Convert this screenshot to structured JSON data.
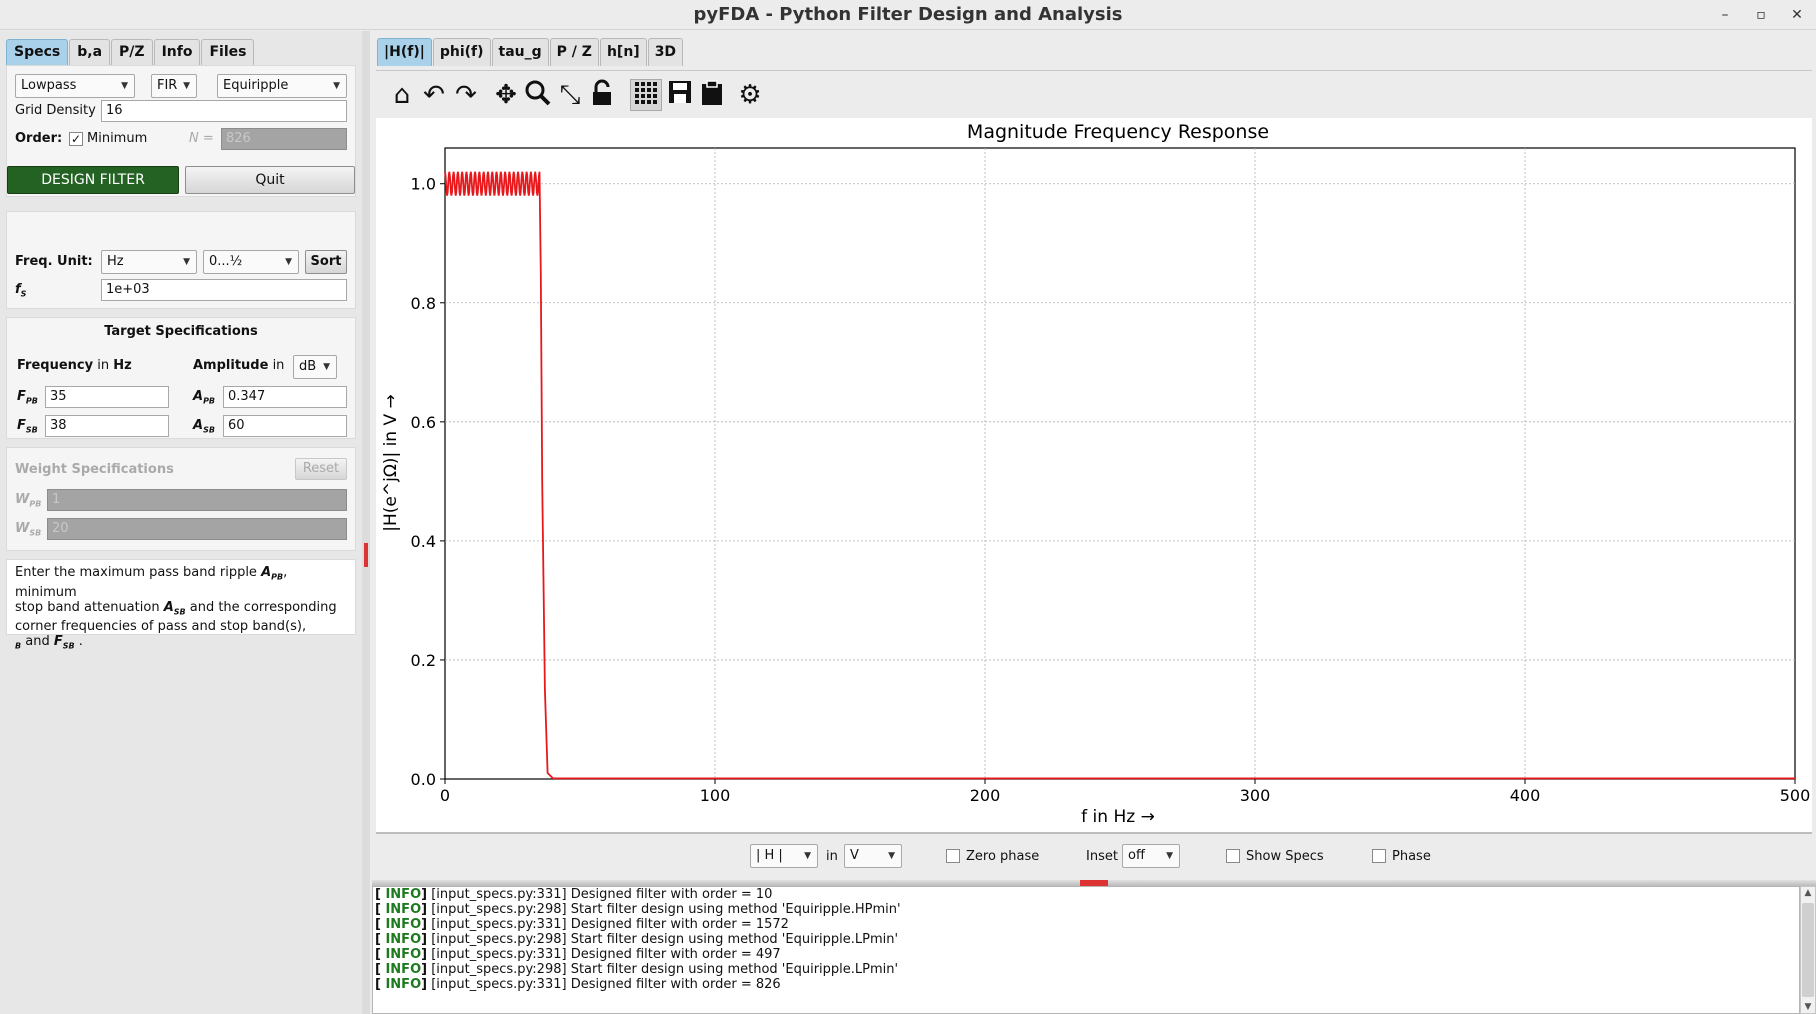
{
  "window": {
    "title": "pyFDA - Python Filter Design and Analysis",
    "minimize": "–",
    "maximize": "▫",
    "close": "✕"
  },
  "left_tabs": [
    "Specs",
    "b,a",
    "P/Z",
    "Info",
    "Files"
  ],
  "filter": {
    "response_type": "Lowpass",
    "filter_class": "FIR",
    "design_method": "Equiripple",
    "grid_density_label": "Grid Density",
    "grid_density": "16",
    "order_label": "Order:",
    "minimum_label": "Minimum",
    "minimum_checked": true,
    "n_label": "N =",
    "n_value": "826",
    "design_button": "DESIGN FILTER",
    "quit_button": "Quit"
  },
  "freq_unit": {
    "label": "Freq. Unit:",
    "unit": "Hz",
    "range": "0...½",
    "sort_button": "Sort",
    "fs_label": "f",
    "fs_sub": "S",
    "fs_value": "1e+03"
  },
  "target_specs": {
    "title": "Target Specifications",
    "frequency_label": "Frequency",
    "frequency_in": "in",
    "frequency_unit": "Hz",
    "amplitude_label": "Amplitude",
    "amplitude_in": "in",
    "amplitude_unit": "dB",
    "fpb_label": "F",
    "fpb_sub": "PB",
    "fpb_value": "35",
    "fsb_label": "F",
    "fsb_sub": "SB",
    "fsb_value": "38",
    "apb_label": "A",
    "apb_sub": "PB",
    "apb_value": "0.347",
    "asb_label": "A",
    "asb_sub": "SB",
    "asb_value": "60"
  },
  "weight_specs": {
    "title": "Weight Specifications",
    "reset_button": "Reset",
    "wpb_label": "W",
    "wpb_sub": "PB",
    "wpb_value": "1",
    "wsb_label": "W",
    "wsb_sub": "SB",
    "wsb_value": "20"
  },
  "info_text": {
    "line1a": "Enter the maximum pass band ripple ",
    "line1b": "A",
    "line1c": "PB",
    "line1d": ", minimum",
    "line2a": "stop band attenuation ",
    "line2b": "A",
    "line2c": "SB",
    "line2d": " and the corresponding",
    "line3": "corner frequencies of pass and stop band(s),",
    "line4a": "B",
    "line4b": "  and ",
    "line4c": "F",
    "line4d": "SB",
    "line4e": " ."
  },
  "right_tabs": [
    "|H(f)|",
    "phi(f)",
    "tau_g",
    "P / Z",
    "h[n]",
    "3D"
  ],
  "toolbar_icons": [
    "home-icon",
    "undo-icon",
    "redo-icon",
    "pan-icon",
    "zoom-icon",
    "autoscale-icon",
    "lock-icon",
    "grid-icon",
    "save-icon",
    "clipboard-icon",
    "settings-icon"
  ],
  "bottom_controls": {
    "magnitude_select": "| H |",
    "in_label": "in",
    "unit_select": "V",
    "zero_phase_label": "Zero phase",
    "inset_label": "Inset",
    "inset_select": "off",
    "show_specs_label": "Show Specs",
    "phase_label": "Phase"
  },
  "log_lines": [
    {
      "tag": "INFO",
      "text": " [input_specs.py:331] Designed filter with order = 10"
    },
    {
      "tag": "INFO",
      "text": " [input_specs.py:298] Start filter design using method 'Equiripple.HPmin'"
    },
    {
      "tag": "INFO",
      "text": " [input_specs.py:331] Designed filter with order = 1572"
    },
    {
      "tag": "INFO",
      "text": " [input_specs.py:298] Start filter design using method 'Equiripple.LPmin'"
    },
    {
      "tag": "INFO",
      "text": " [input_specs.py:331] Designed filter with order = 497"
    },
    {
      "tag": "INFO",
      "text": " [input_specs.py:298] Start filter design using method 'Equiripple.LPmin'"
    },
    {
      "tag": "INFO",
      "text": " [input_specs.py:331] Designed filter with order = 826"
    }
  ],
  "colors": {
    "accent_tab": "#a9d1ea",
    "design_button": "#246224",
    "plot_line": "#e8171b",
    "log_tag": "#1e7a1e"
  },
  "chart_data": {
    "type": "line",
    "title": "Magnitude Frequency Response",
    "xlabel": "f in Hz →",
    "ylabel": "|H(e^jΩ)| in V →",
    "xlim": [
      0,
      500
    ],
    "ylim": [
      0,
      1.06
    ],
    "xticks": [
      "0",
      "100",
      "200",
      "300",
      "400",
      "500"
    ],
    "yticks": [
      "0.0",
      "0.2",
      "0.4",
      "0.6",
      "0.8",
      "1.0"
    ],
    "grid": true,
    "series": [
      {
        "x": [
          0,
          35,
          35.5,
          36,
          37,
          38,
          40,
          500
        ],
        "y": [
          1.0,
          1.0,
          0.85,
          0.5,
          0.15,
          0.01,
          0.001,
          0.001
        ],
        "passband_ripple_peak": 1.02,
        "passband_ripple_trough": 0.98,
        "passband_ripples": 22
      }
    ]
  }
}
